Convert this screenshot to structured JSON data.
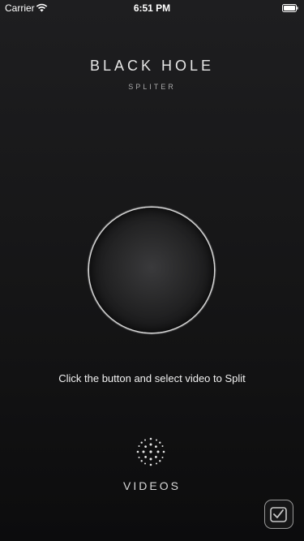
{
  "status_bar": {
    "carrier": "Carrier",
    "time": "6:51 PM",
    "icons": [
      "wifi-icon",
      "battery-icon"
    ]
  },
  "header": {
    "title": "BLACK HOLE",
    "subtitle": "SPLITER"
  },
  "main": {
    "instruction": "Click the button and select video to Split"
  },
  "footer": {
    "videos_label": "VIDEOS",
    "videos_icon": "dots-burst-icon",
    "corner_icon": "app-badge-icon"
  },
  "colors": {
    "background_top": "#1e1e20",
    "background_bottom": "#0c0c0d",
    "ring": "#d8d8d8",
    "text": "#ffffff"
  }
}
